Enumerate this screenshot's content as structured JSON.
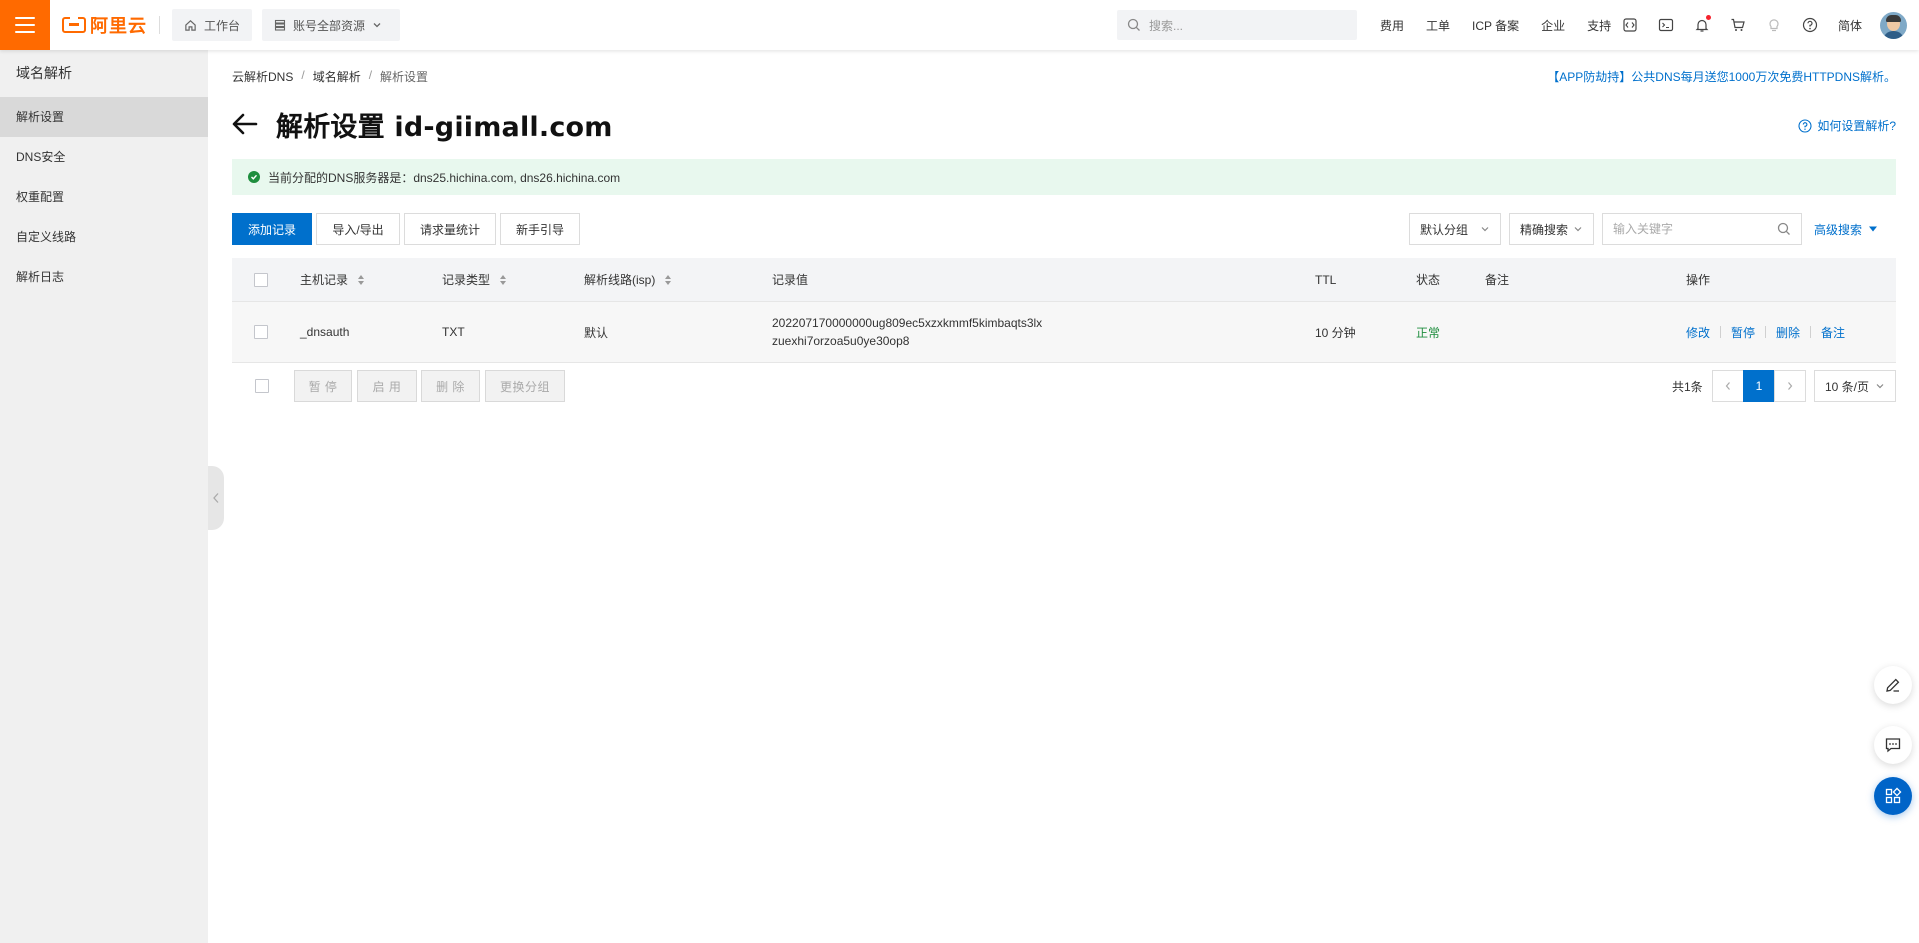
{
  "brand": {
    "logo_text": "阿里云",
    "accent": "#ff6a00"
  },
  "topbar": {
    "workbench_label": "工作台",
    "resources_label": "账号全部资源",
    "search_placeholder": "搜索...",
    "links": [
      "费用",
      "工单",
      "ICP 备案",
      "企业",
      "支持"
    ],
    "language": "简体"
  },
  "sidebar": {
    "title": "域名解析",
    "items": [
      {
        "label": "解析设置",
        "active": true
      },
      {
        "label": "DNS安全"
      },
      {
        "label": "权重配置"
      },
      {
        "label": "自定义线路"
      },
      {
        "label": "解析日志"
      }
    ]
  },
  "breadcrumb": [
    "云解析DNS",
    "域名解析",
    "解析设置"
  ],
  "promo_text": "【APP防劫持】公共DNS每月送您1000万次免费HTTPDNS解析。",
  "page_title": "解析设置 id-giimall.com",
  "help_link": "如何设置解析?",
  "dns_info": "当前分配的DNS服务器是：dns25.hichina.com, dns26.hichina.com",
  "toolbar": {
    "add_record": "添加记录",
    "import_export": "导入/导出",
    "request_stats": "请求量统计",
    "guide": "新手引导",
    "group_select": "默认分组",
    "search_mode": "精确搜索",
    "keyword_placeholder": "输入关键字",
    "advanced_search": "高级搜索"
  },
  "table": {
    "headers": {
      "host": "主机记录",
      "type": "记录类型",
      "line": "解析线路(isp)",
      "value": "记录值",
      "ttl": "TTL",
      "status": "状态",
      "remark": "备注",
      "actions": "操作"
    },
    "rows": [
      {
        "host": "_dnsauth",
        "type": "TXT",
        "line": "默认",
        "value_line1": "202207170000000ug809ec5xzxkmmf5kimbaqts3lx",
        "value_line2": "zuexhi7orzoa5u0ye30op8",
        "ttl": "10 分钟",
        "status": "正常",
        "remark": "",
        "actions": [
          "修改",
          "暂停",
          "删除",
          "备注"
        ]
      }
    ]
  },
  "batch": {
    "pause": "暂 停",
    "enable": "启 用",
    "delete": "删 除",
    "change_group": "更换分组"
  },
  "pagination": {
    "total": "共1条",
    "current_page": "1",
    "page_size": "10 条/页"
  },
  "colors": {
    "primary": "#0070cc",
    "success": "#1e8e3e",
    "info_bg": "#e8f8ee"
  }
}
